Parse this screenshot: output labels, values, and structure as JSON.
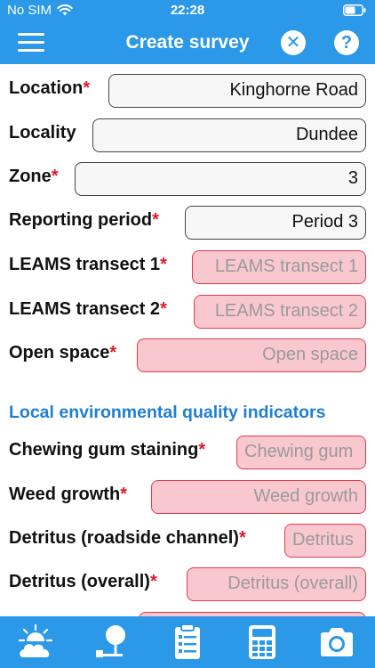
{
  "status_bar": {
    "carrier": "No SIM",
    "time": "22:28"
  },
  "header": {
    "title": "Create survey",
    "menu_icon": "hamburger-menu-icon",
    "close_icon": "close-circle-icon",
    "help_icon": "help-circle-icon"
  },
  "form": {
    "location": {
      "label": "Location",
      "required": "*",
      "value": "Kinghorne Road"
    },
    "locality": {
      "label": "Locality",
      "value": "Dundee"
    },
    "zone": {
      "label": "Zone",
      "required": "*",
      "value": "3"
    },
    "reporting_period": {
      "label": "Reporting period",
      "required": "*",
      "value": "Period 3"
    },
    "leams_transect_1": {
      "label": "LEAMS transect 1",
      "required": "*",
      "placeholder": "LEAMS transect 1"
    },
    "leams_transect_2": {
      "label": "LEAMS transect 2",
      "required": "*",
      "placeholder": "LEAMS transect 2"
    },
    "open_space": {
      "label": "Open space",
      "required": "*",
      "placeholder": "Open space"
    }
  },
  "indicators": {
    "heading": "Local environmental quality indicators",
    "chewing_gum": {
      "label": "Chewing gum staining",
      "required": "*",
      "placeholder": "Chewing gum"
    },
    "weed_growth": {
      "label": "Weed growth",
      "required": "*",
      "placeholder": "Weed growth"
    },
    "detritus_roadside": {
      "label": "Detritus (roadside channel)",
      "required": "*",
      "placeholder": "Detritus"
    },
    "detritus_overall": {
      "label": "Detritus (overall)",
      "required": "*",
      "placeholder": "Detritus (overall)"
    }
  },
  "tab_bar": {
    "tabs": [
      "weather-icon",
      "tree-icon",
      "clipboard-icon",
      "calculator-icon",
      "camera-icon"
    ]
  },
  "colors": {
    "primary": "#2b98e8",
    "required_mark": "#e0192b",
    "empty_field_bg": "#f9c8cf",
    "section_heading": "#1f7fd3"
  }
}
